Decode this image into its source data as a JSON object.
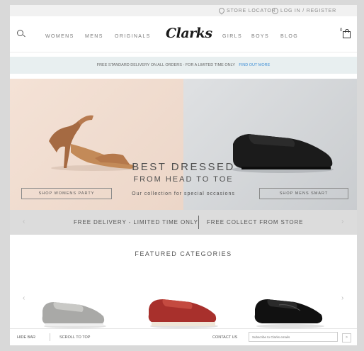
{
  "utility": {
    "store_locator": "STORE LOCATOR",
    "login": "LOG IN / REGISTER",
    "icons": [
      "location-pin-icon",
      "user-icon"
    ]
  },
  "nav": {
    "left_links": [
      "WOMENS",
      "MENS",
      "ORIGINALS"
    ],
    "logo": "Clarks",
    "right_links": [
      "GIRLS",
      "BOYS",
      "BLOG"
    ],
    "cart_count": "0",
    "icons": [
      "search-icon",
      "bag-icon"
    ]
  },
  "promo": {
    "text": "FREE STANDARD DELIVERY ON ALL ORDERS - FOR A LIMITED TIME ONLY",
    "link": "FIND OUT MORE"
  },
  "hero": {
    "line1": "BEST DRESSED",
    "line2": "FROM HEAD TO TOE",
    "subtitle": "Our collection for special occasions",
    "left_button": "SHOP WOMENS PARTY",
    "right_button": "SHOP MENS SMART"
  },
  "delivery_strip": {
    "left_text": "FREE DELIVERY - LIMITED TIME ONLY",
    "right_text": "FREE COLLECT FROM STORE",
    "prev_icon": "chevron-left-icon",
    "next_icon": "chevron-right-icon"
  },
  "featured": {
    "title": "FEATURED CATEGORIES"
  },
  "footer": {
    "hide_bar": "HIDE BAR",
    "scroll_top": "SCROLL TO TOP",
    "contact": "CONTACT US",
    "subscribe_placeholder": "Subscribe to Clarks emails",
    "submit": ">"
  },
  "colors": {
    "accent_link": "#3f8fd6",
    "promo_bg": "#e8eff0",
    "strip_bg": "#dcdcdc"
  }
}
